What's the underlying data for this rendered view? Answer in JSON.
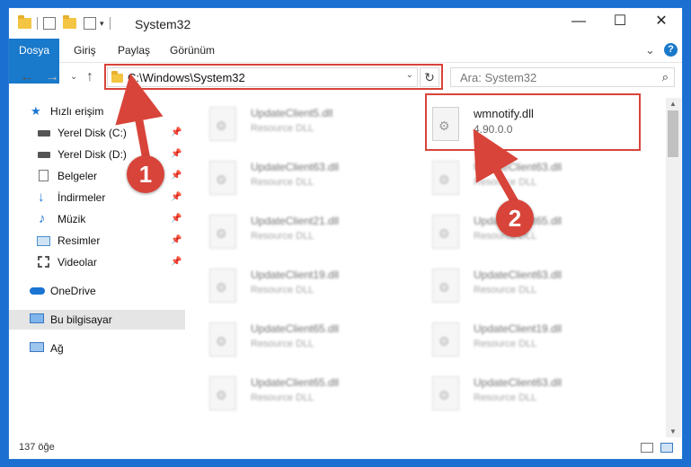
{
  "window": {
    "title": "System32",
    "minimize": "—",
    "maximize": "☐",
    "close": "✕",
    "help": "?",
    "collapse": "⌄"
  },
  "ribbon": {
    "tabs": [
      "Dosya",
      "Giriş",
      "Paylaş",
      "Görünüm"
    ]
  },
  "nav": {
    "back": "←",
    "forward": "→",
    "recent": "⌄",
    "up": "↑",
    "address": "C:\\Windows\\System32",
    "address_dropdown": "⌄",
    "refresh": "↻",
    "search_placeholder": "Ara: System32",
    "search_icon": "⌕"
  },
  "sidebar": {
    "items": [
      {
        "label": "Hızlı erişim",
        "icon": "star-icon"
      },
      {
        "label": "Yerel Disk (C:)",
        "icon": "drive-icon",
        "pinned": true
      },
      {
        "label": "Yerel Disk (D:)",
        "icon": "drive-icon",
        "pinned": true
      },
      {
        "label": "Belgeler",
        "icon": "documents-icon",
        "pinned": true
      },
      {
        "label": "İndirmeler",
        "icon": "download-icon",
        "pinned": true
      },
      {
        "label": "Müzik",
        "icon": "music-icon",
        "pinned": true
      },
      {
        "label": "Resimler",
        "icon": "pictures-icon",
        "pinned": true
      },
      {
        "label": "Videolar",
        "icon": "videos-icon",
        "pinned": true
      },
      {
        "label": "OneDrive",
        "icon": "cloud-icon"
      },
      {
        "label": "Bu bilgisayar",
        "icon": "computer-icon",
        "selected": true
      },
      {
        "label": "Ağ",
        "icon": "network-icon"
      }
    ]
  },
  "files": {
    "left": [
      {
        "name": "UpdateClient5.dll",
        "desc": "Resource DLL"
      },
      {
        "name": "UpdateClient63.dll",
        "desc": "Resource DLL"
      },
      {
        "name": "UpdateClient21.dll",
        "desc": "Resource DLL"
      },
      {
        "name": "UpdateClient19.dll",
        "desc": "Resource DLL"
      },
      {
        "name": "UpdateClient65.dll",
        "desc": "Resource DLL"
      },
      {
        "name": "UpdateClient65.dll",
        "desc": "Resource DLL"
      }
    ],
    "right": [
      {
        "name": "wmnotify.dll",
        "desc": "4.90.0.0"
      },
      {
        "name": "UpdateClient63.dll",
        "desc": "Resource DLL"
      },
      {
        "name": "UpdateClient65.dll",
        "desc": "Resource DLL"
      },
      {
        "name": "UpdateClient63.dll",
        "desc": "Resource DLL"
      },
      {
        "name": "UpdateClient19.dll",
        "desc": "Resource DLL"
      },
      {
        "name": "UpdateClient63.dll",
        "desc": "Resource DLL"
      }
    ]
  },
  "status": {
    "count": "137 öğe"
  },
  "annotations": {
    "step1": "1",
    "step2": "2",
    "color": "#d8443a"
  }
}
